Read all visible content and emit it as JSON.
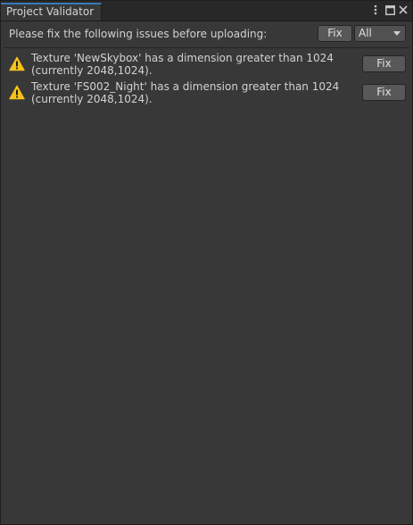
{
  "window": {
    "tab_title": "Project Validator",
    "icons": [
      "kebab-menu-icon",
      "maximize-icon",
      "close-icon"
    ]
  },
  "toolbar": {
    "message": "Please fix the following issues before uploading:",
    "fix_label": "Fix",
    "filter_value": "All"
  },
  "issues": [
    {
      "icon": "warning-icon",
      "message": "Texture 'NewSkybox' has a dimension greater than 1024 (currently 2048,1024).",
      "fix_label": "Fix"
    },
    {
      "icon": "warning-icon",
      "message": "Texture 'FS002_Night' has a dimension greater than 1024 (currently 2048,1024).",
      "fix_label": "Fix"
    }
  ],
  "colors": {
    "panel_bg": "#383838",
    "tab_accent": "#3a79bb",
    "warning": "#f4c21b"
  }
}
